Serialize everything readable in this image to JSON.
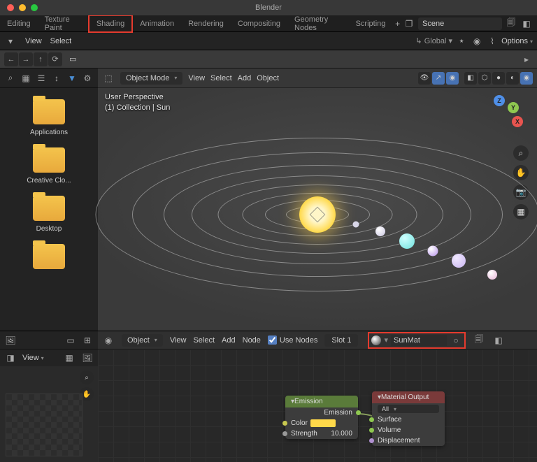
{
  "app_title": "Blender",
  "top_tabs": [
    "Editing",
    "Texture Paint",
    "Shading",
    "Animation",
    "Rendering",
    "Compositing",
    "Geometry Nodes",
    "Scripting"
  ],
  "scene_name": "Scene",
  "menubar": {
    "view": "View",
    "select": "Select",
    "options": "Options"
  },
  "toolstrip_global": "Global",
  "vp": {
    "mode": "Object Mode",
    "menus": [
      "View",
      "Select",
      "Add",
      "Object"
    ],
    "persp_l1": "User Perspective",
    "persp_l2": "(1) Collection | Sun"
  },
  "folders": [
    "Applications",
    "Creative Clo...",
    "Desktop"
  ],
  "img": {
    "view": "View"
  },
  "node_head": {
    "mode": "Object",
    "menus": [
      "View",
      "Select",
      "Add",
      "Node"
    ],
    "use_nodes": "Use Nodes",
    "slot": "Slot 1",
    "mat": "SunMat"
  },
  "nodes": {
    "emission": {
      "title": "Emission",
      "out": "Emission",
      "color": "Color",
      "strength_l": "Strength",
      "strength_v": "10.000"
    },
    "output": {
      "title": "Material Output",
      "all": "All",
      "surface": "Surface",
      "volume": "Volume",
      "disp": "Displacement"
    }
  },
  "gizmo": {
    "x": "X",
    "y": "Y",
    "z": "Z"
  }
}
